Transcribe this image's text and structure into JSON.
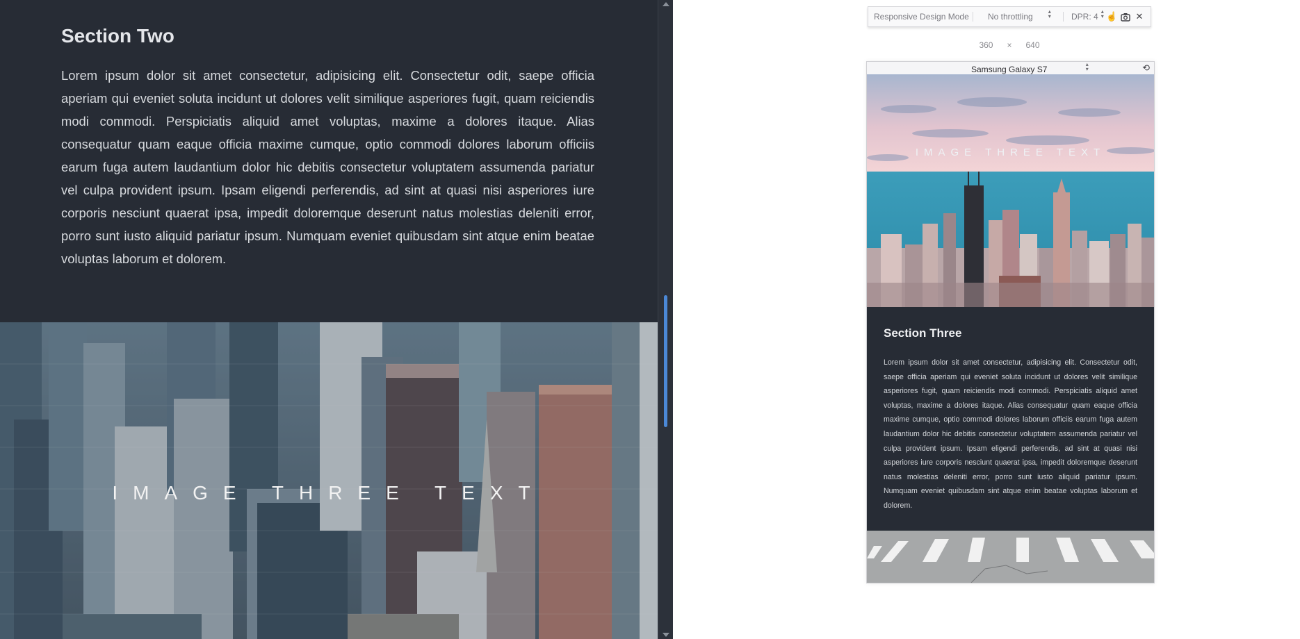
{
  "left": {
    "heading": "Section Two",
    "body": "Lorem ipsum dolor sit amet consectetur, adipisicing elit. Consectetur odit, saepe officia aperiam qui eveniet soluta incidunt ut dolores velit similique asperiores fugit, quam reiciendis modi commodi. Perspiciatis aliquid amet voluptas, maxime a dolores itaque. Alias consequatur quam eaque officia maxime cumque, optio commodi dolores laborum officiis earum fuga autem laudantium dolor hic debitis consectetur voluptatem assumenda pariatur vel culpa provident ipsum. Ipsam eligendi perferendis, ad sint at quasi nisi asperiores iure corporis nesciunt quaerat ipsa, impedit doloremque deserunt natus molestias deleniti error, porro sunt iusto aliquid pariatur ipsum. Numquam eveniet quibusdam sint atque enim beatae voluptas laborum et dolorem.",
    "image_caption": "IMAGE THREE TEXT"
  },
  "toolbar": {
    "mode_label": "Responsive Design Mode",
    "throttling": "No throttling",
    "dpr": "DPR: 4",
    "icons": [
      "touch-simulation-icon",
      "screenshot-icon",
      "close-icon"
    ]
  },
  "dimensions": {
    "width": "360",
    "separator": "×",
    "height": "640"
  },
  "device": {
    "name": "Samsung Galaxy S7",
    "rotate_icon": "rotate-icon"
  },
  "phone": {
    "image_caption": "IMAGE THREE TEXT",
    "heading": "Section Three",
    "body": "Lorem ipsum dolor sit amet consectetur, adipisicing elit. Consectetur odit, saepe officia aperiam qui eveniet soluta incidunt ut dolores velit similique asperiores fugit, quam reiciendis modi commodi. Perspiciatis aliquid amet voluptas, maxime a dolores itaque. Alias consequatur quam eaque officia maxime cumque, optio commodi dolores laborum officiis earum fuga autem laudantium dolor hic debitis consectetur voluptatem assumenda pariatur vel culpa provident ipsum. Ipsam eligendi perferendis, ad sint at quasi nisi asperiores iure corporis nesciunt quaerat ipsa, impedit doloremque deserunt natus molestias deleniti error, porro sunt iusto aliquid pariatur ipsum. Numquam eveniet quibusdam sint atque enim beatae voluptas laborum et dolorem."
  },
  "colors": {
    "page_background": "#272c35",
    "scroll_thumb": "#4b88d6",
    "touch_active": "#0a84ff"
  }
}
